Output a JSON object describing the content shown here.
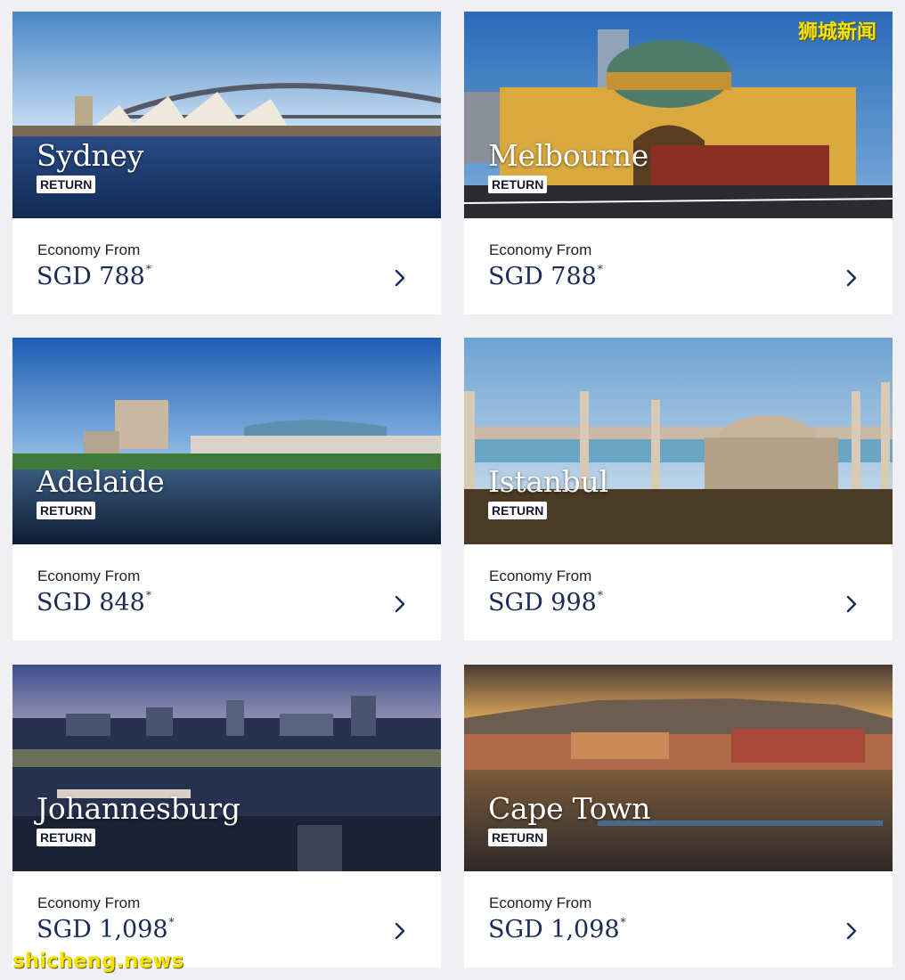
{
  "cards": [
    {
      "city": "Sydney",
      "tag": "RETURN",
      "label": "Economy From",
      "price": "SGD 788",
      "asterisk": "*"
    },
    {
      "city": "Melbourne",
      "tag": "RETURN",
      "label": "Economy From",
      "price": "SGD 788",
      "asterisk": "*"
    },
    {
      "city": "Adelaide",
      "tag": "RETURN",
      "label": "Economy From",
      "price": "SGD 848",
      "asterisk": "*"
    },
    {
      "city": "Istanbul",
      "tag": "RETURN",
      "label": "Economy From",
      "price": "SGD 998",
      "asterisk": "*"
    },
    {
      "city": "Johannesburg",
      "tag": "RETURN",
      "label": "Economy From",
      "price": "SGD 1,098",
      "asterisk": "*"
    },
    {
      "city": "Cape Town",
      "tag": "RETURN",
      "label": "Economy From",
      "price": "SGD 1,098",
      "asterisk": "*"
    }
  ],
  "watermarks": {
    "top_right": "狮城新闻",
    "bottom_left": "shicheng.news"
  },
  "icons": {
    "card_arrow": "chevron-right-icon"
  },
  "colors": {
    "page_background": "#f0f0f2",
    "price_text": "#1b2a57",
    "watermark": "#f5e200"
  }
}
